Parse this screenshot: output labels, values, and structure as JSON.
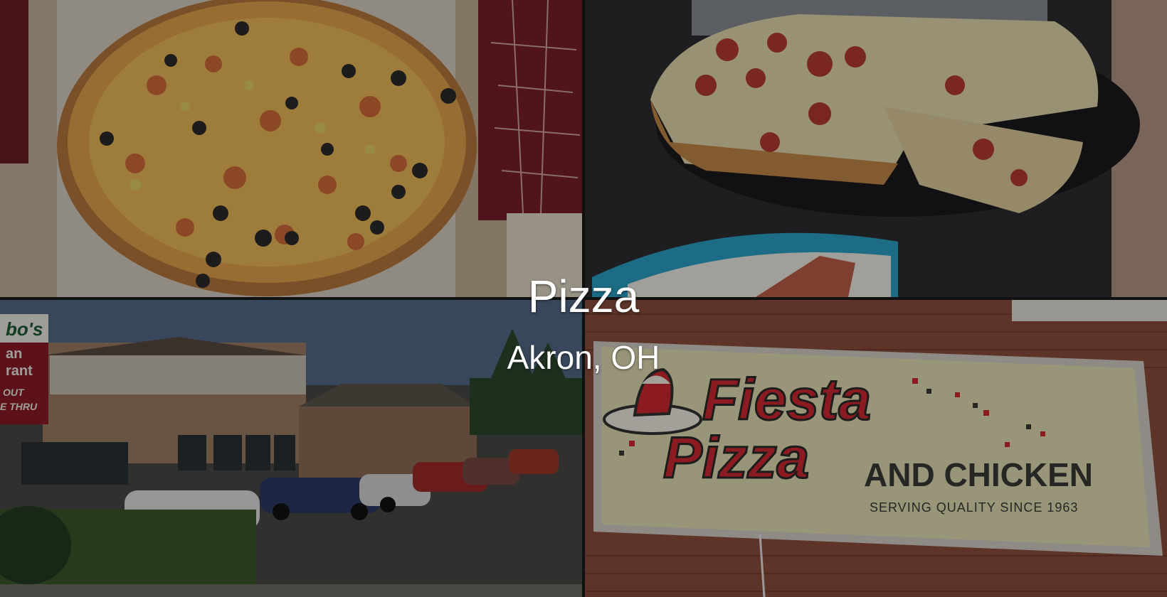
{
  "hero": {
    "title": "Pizza",
    "subtitle": "Akron, OH"
  },
  "photos": {
    "top_left": {
      "label": "pizza-box-photo"
    },
    "top_right": {
      "label": "pan-pizza-photo"
    },
    "bottom_left": {
      "label": "restaurant-exterior-photo",
      "sign_lines": [
        "bo's",
        "an",
        "rant",
        "OUT",
        "E THRU"
      ]
    },
    "bottom_right": {
      "label": "sign-photo",
      "sign_word1": "Fiesta",
      "sign_word2": "Pizza",
      "sign_word3": "AND CHICKEN",
      "sign_tagline": "SERVING QUALITY SINCE 1963"
    }
  },
  "colors": {
    "overlay": "#000000",
    "sign_red": "#d42a32",
    "sign_dark": "#3a3a38",
    "sign_bg": "#e8e2b6"
  }
}
